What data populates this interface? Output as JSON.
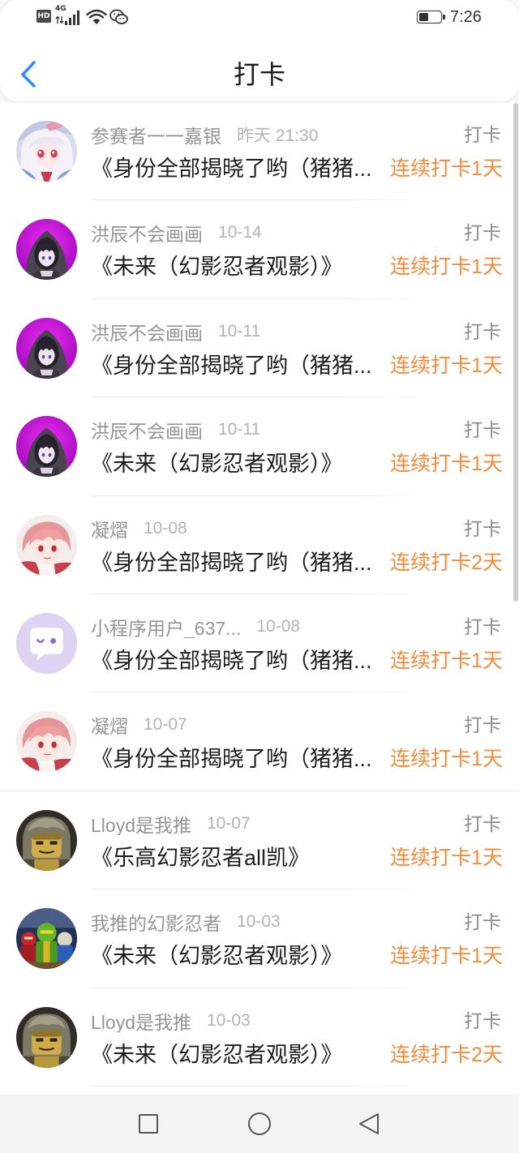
{
  "status_bar": {
    "hd": "HD",
    "network": "4G",
    "time": "7:26",
    "battery_level": 0.45,
    "icons": [
      "hd-icon",
      "signal-icon",
      "wifi-icon",
      "wechat-icon",
      "battery-icon"
    ]
  },
  "header": {
    "title": "打卡",
    "back_icon": "chevron-left-icon"
  },
  "colors": {
    "accent": "#2e8ff0",
    "streak": "#f28b3b"
  },
  "items": [
    {
      "avatar": "anime-white-hair-avatar",
      "name": "参赛者一一嘉银",
      "time": "昨天 21:30",
      "tag": "打卡",
      "title": "《身份全部揭晓了哟（猪猪...",
      "streak": "连续打卡1天"
    },
    {
      "avatar": "hooded-figure-avatar",
      "name": "洪辰不会画画",
      "time": "10-14",
      "tag": "打卡",
      "title": "《未来（幻影忍者观影）》",
      "streak": "连续打卡1天"
    },
    {
      "avatar": "hooded-figure-avatar",
      "name": "洪辰不会画画",
      "time": "10-11",
      "tag": "打卡",
      "title": "《身份全部揭晓了哟（猪猪...",
      "streak": "连续打卡1天"
    },
    {
      "avatar": "hooded-figure-avatar",
      "name": "洪辰不会画画",
      "time": "10-11",
      "tag": "打卡",
      "title": "《未来（幻影忍者观影）》",
      "streak": "连续打卡1天"
    },
    {
      "avatar": "pink-hair-avatar",
      "name": "凝熠",
      "time": "10-08",
      "tag": "打卡",
      "title": "《身份全部揭晓了哟（猪猪...",
      "streak": "连续打卡2天"
    },
    {
      "avatar": "default-bubble-avatar",
      "name": "小程序用户_637...",
      "time": "10-08",
      "tag": "打卡",
      "title": "《身份全部揭晓了哟（猪猪...",
      "streak": "连续打卡1天"
    },
    {
      "avatar": "pink-hair-avatar",
      "name": "凝熠",
      "time": "10-07",
      "tag": "打卡",
      "title": "《身份全部揭晓了哟（猪猪...",
      "streak": "连续打卡1天"
    },
    {
      "avatar": "lego-lloyd-avatar",
      "name": "Lloyd是我推",
      "time": "10-07",
      "tag": "打卡",
      "title": "《乐高幻影忍者all凯》",
      "streak": "连续打卡1天"
    },
    {
      "avatar": "lego-ninjas-avatar",
      "name": "我推的幻影忍者",
      "time": "10-03",
      "tag": "打卡",
      "title": "《未来（幻影忍者观影）》",
      "streak": "连续打卡1天"
    },
    {
      "avatar": "lego-lloyd-avatar",
      "name": "Lloyd是我推",
      "time": "10-03",
      "tag": "打卡",
      "title": "《未来（幻影忍者观影）》",
      "streak": "连续打卡2天"
    }
  ],
  "nav_bar": {
    "icons": [
      "recent-apps-icon",
      "home-icon",
      "back-triangle-icon"
    ]
  }
}
